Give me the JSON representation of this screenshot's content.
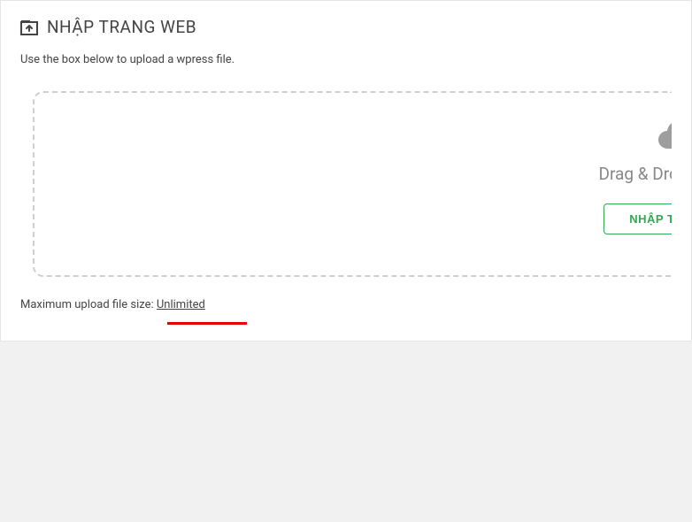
{
  "header": {
    "title": "NHẬP TRANG WEB"
  },
  "description": "Use the box below to upload a wpress file.",
  "dropzone": {
    "text": "Drag & Drop to upload",
    "button_label": "NHẬP TỪ"
  },
  "footer": {
    "max_upload_label": "Maximum upload file size: ",
    "max_upload_value": "Unlimited"
  }
}
